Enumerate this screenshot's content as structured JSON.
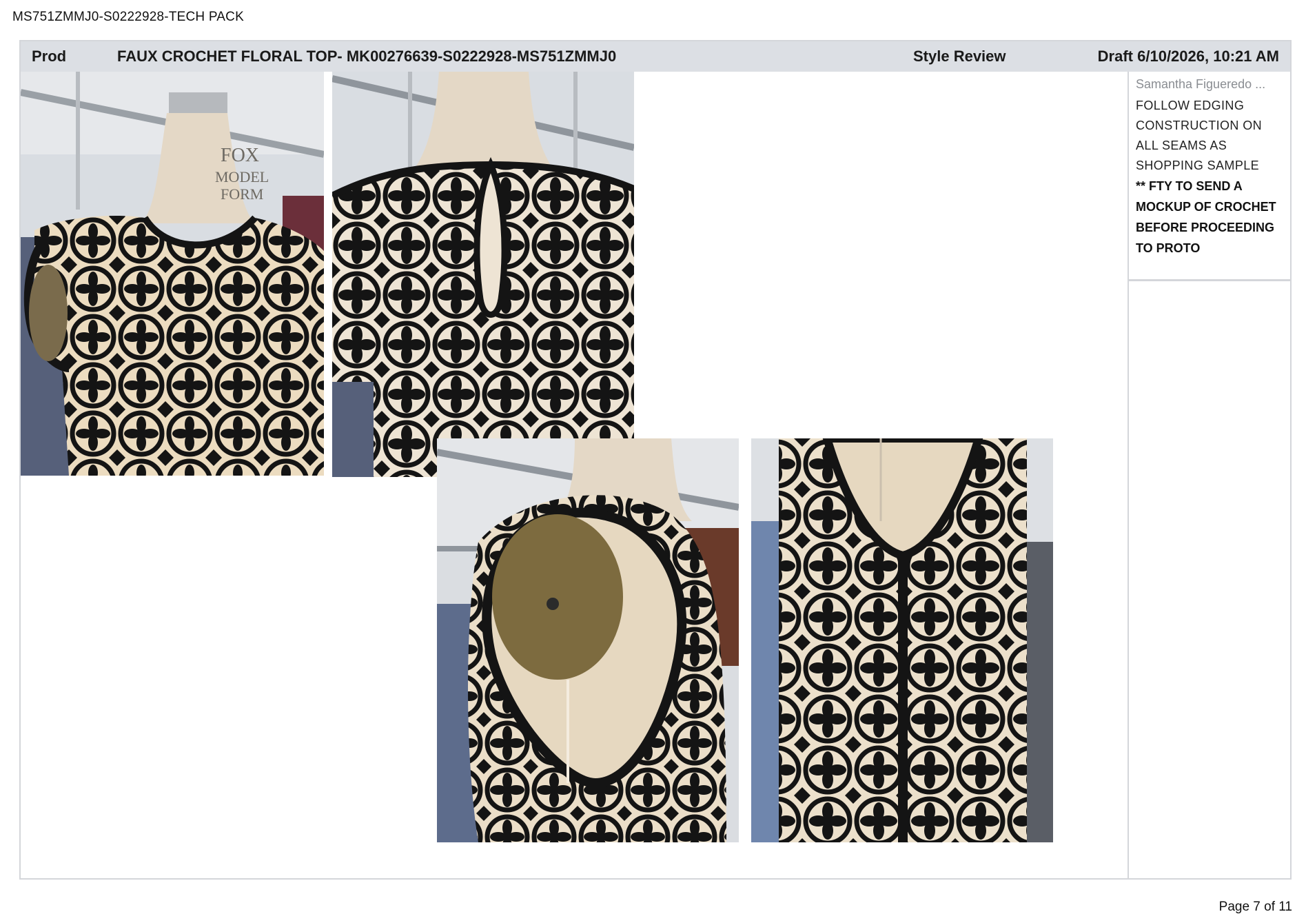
{
  "document_header": "MS751ZMMJ0-S0222928-TECH PACK",
  "title_bar": {
    "stage": "Prod",
    "title": "FAUX CROCHET FLORAL TOP- MK00276639-S0222928-MS751ZMMJ0",
    "review": "Style Review",
    "draft": "Draft 6/10/2026, 10:21 AM"
  },
  "comment": {
    "author": "Samantha Figueredo ...",
    "text": "FOLLOW EDGING CONSTRUCTION ON ALL SEAMS AS SHOPPING SAMPLE",
    "bold_text": "** FTY TO SEND A MOCKUP OF CROCHET BEFORE PROCEEDING TO PROTO"
  },
  "photos": [
    {
      "name": "front-neckline-photo",
      "mannequin_label": "FOX MODEL FORM"
    },
    {
      "name": "back-keyhole-photo"
    },
    {
      "name": "side-armhole-photo"
    },
    {
      "name": "back-seam-photo"
    }
  ],
  "colors": {
    "crochet": "#141414",
    "mannequin": "#e9dcc6",
    "header_bar": "#dcdfe4",
    "border": "#d4d6da"
  },
  "page_number": "Page 7 of 11"
}
